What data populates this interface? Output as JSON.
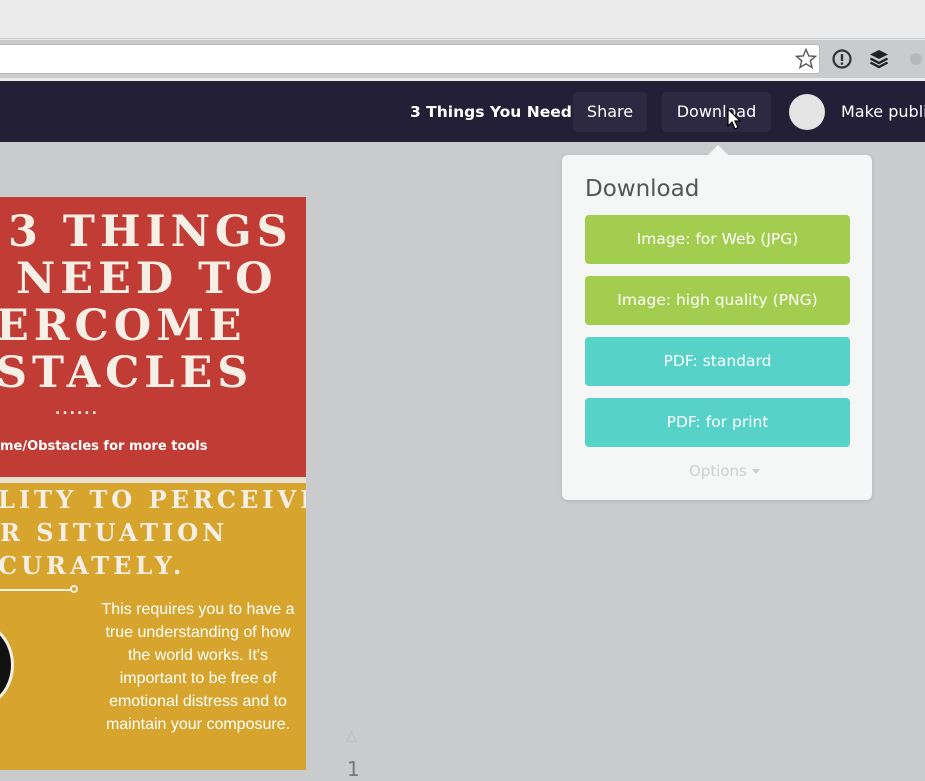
{
  "header": {
    "doc_title": "3 Things You Need",
    "share_label": "Share",
    "download_label": "Download",
    "make_public_label": "Make publi"
  },
  "design": {
    "headline_lines": [
      "3 THINGS",
      "NEED TO",
      "ERCOME",
      "STACLES"
    ],
    "dots": "......",
    "tagline": "me/Obstacles for more tools",
    "subhead_lines": [
      "LITY TO PERCEIVE",
      "R SITUATION",
      "CURATELY."
    ],
    "body_text": "This requires you to have a true understanding of how the world works. It's important to be free of emotional distress and to maintain your composure."
  },
  "page_number": "1",
  "download_popover": {
    "title": "Download",
    "options": [
      {
        "label": "Image: for Web (JPG)",
        "color": "#a3cd4f"
      },
      {
        "label": "Image: high quality (PNG)",
        "color": "#a3cd4f"
      },
      {
        "label": "PDF: standard",
        "color": "#56d2c9"
      },
      {
        "label": "PDF: for print",
        "color": "#56d2c9"
      }
    ],
    "options_toggle": "Options"
  },
  "colors": {
    "header_bg": "#231f36",
    "red_panel": "#c13c35",
    "yellow_panel": "#d7a52e"
  }
}
